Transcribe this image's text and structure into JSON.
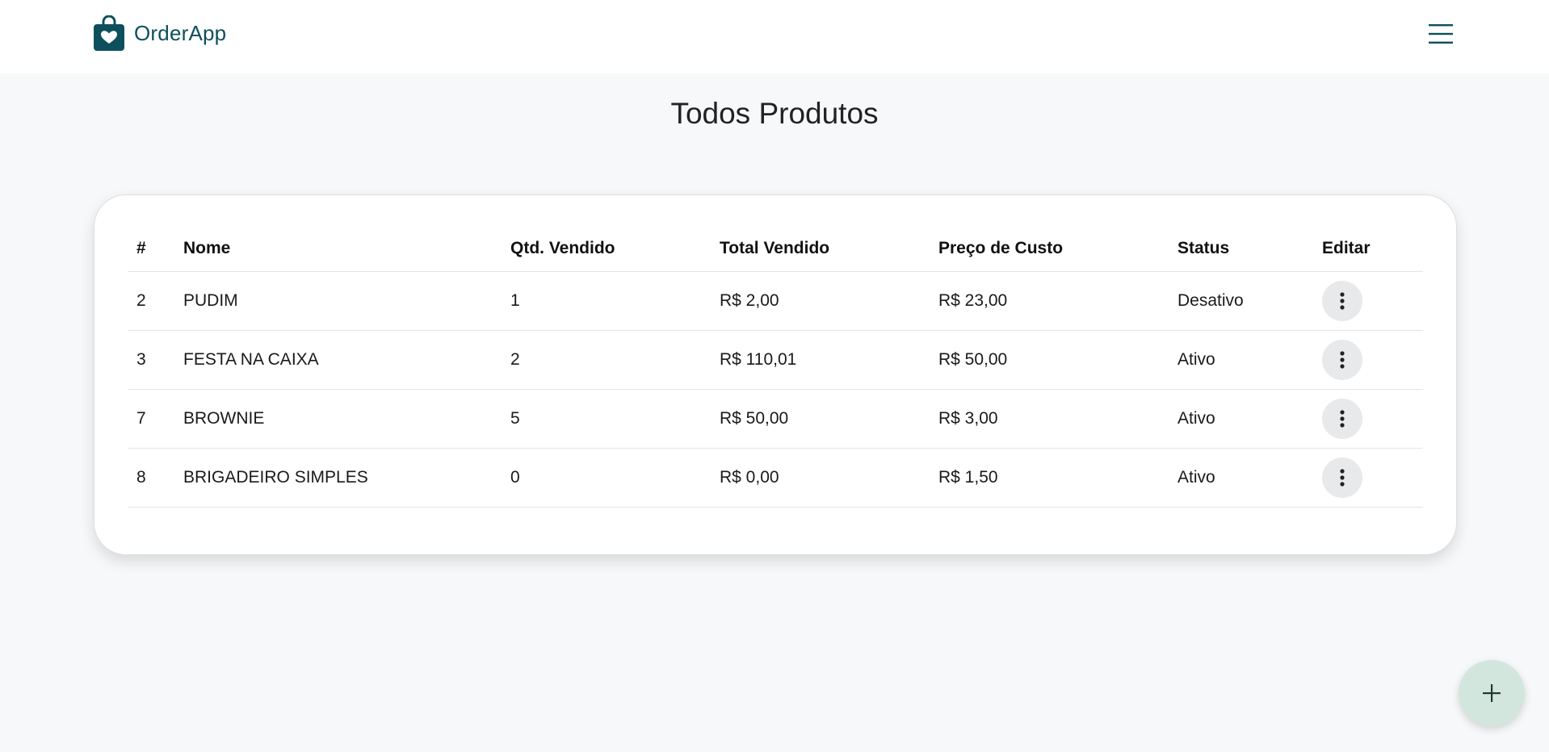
{
  "app": {
    "brand": "OrderApp",
    "brand_color": "#0d4f5c"
  },
  "page": {
    "title": "Todos Produtos"
  },
  "table": {
    "headers": [
      "#",
      "Nome",
      "Qtd. Vendido",
      "Total Vendido",
      "Preço de Custo",
      "Status",
      "Editar"
    ],
    "rows": [
      {
        "id": "2",
        "nome": "PUDIM",
        "qtd": "1",
        "total": "R$ 2,00",
        "custo": "R$ 23,00",
        "status": "Desativo"
      },
      {
        "id": "3",
        "nome": "FESTA NA CAIXA",
        "qtd": "2",
        "total": "R$ 110,01",
        "custo": "R$ 50,00",
        "status": "Ativo"
      },
      {
        "id": "7",
        "nome": "BROWNIE",
        "qtd": "5",
        "total": "R$ 50,00",
        "custo": "R$ 3,00",
        "status": "Ativo"
      },
      {
        "id": "8",
        "nome": "BRIGADEIRO SIMPLES",
        "qtd": "0",
        "total": "R$ 0,00",
        "custo": "R$ 1,50",
        "status": "Ativo"
      }
    ]
  },
  "icons": {
    "brand": "shopping-bag-heart-icon",
    "menu": "hamburger-menu-icon",
    "row_action": "more-vertical-icon",
    "fab": "plus-icon"
  },
  "colors": {
    "background": "#f7f8f9",
    "fab": "#d2e6de",
    "kebab_bg": "#e7e9eb"
  }
}
